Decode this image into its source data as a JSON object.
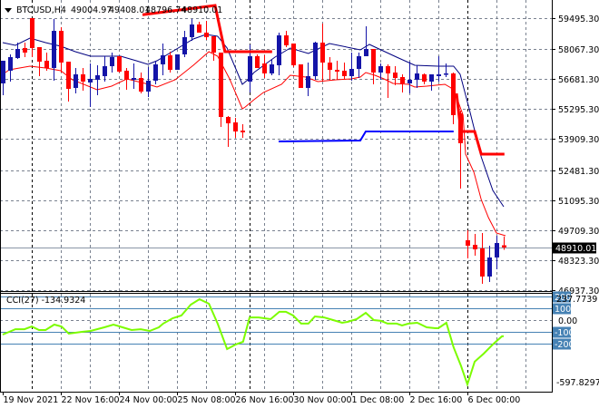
{
  "header": {
    "symbol": "BTCUSD,H4",
    "open": "49004.97",
    "high": "49408.01",
    "low": "48796.74",
    "close": "48910.01",
    "menu_icon": "triangle-down-icon"
  },
  "indicator": {
    "label": "CCI(27) -134.9324",
    "top_value": "237.7739",
    "bottom_value": "-597.8297",
    "levels": [
      {
        "value": 200,
        "label": "200",
        "boxed": true
      },
      {
        "value": 100,
        "label": "100",
        "boxed": true
      },
      {
        "value": 0,
        "label": "0.00",
        "boxed": false
      },
      {
        "value": -100,
        "label": "-100",
        "boxed": true
      },
      {
        "value": -200,
        "label": "-200",
        "boxed": true
      }
    ]
  },
  "colors": {
    "bull": "#1414a8",
    "bear": "#ff0000",
    "ma_fast": "#000080",
    "ma_slow": "#ff0000",
    "step_upper": "#ff0000",
    "step_lower": "#0000ff",
    "cci": "#7cfc00",
    "level_line": "#4682b4",
    "label_box": "#4682b4",
    "grid": "#7a8290"
  },
  "chart_data": {
    "type": "candlestick",
    "title": "BTCUSD,H4",
    "price_ticks": [
      "59495.30",
      "58067.30",
      "56681.30",
      "55295.30",
      "53909.30",
      "52481.30",
      "51095.30",
      "49709.30",
      "48323.30",
      "46937.30"
    ],
    "current_price": "48910.01",
    "time_labels": [
      {
        "bar": 0,
        "label": "19 Nov 2021"
      },
      {
        "bar": 8,
        "label": "22 Nov 16:00"
      },
      {
        "bar": 16,
        "label": "24 Nov 00:00"
      },
      {
        "bar": 24,
        "label": "25 Nov 08:00"
      },
      {
        "bar": 32,
        "label": "26 Nov 16:00"
      },
      {
        "bar": 40,
        "label": "30 Nov 00:00"
      },
      {
        "bar": 48,
        "label": "1 Dec 08:00"
      },
      {
        "bar": 56,
        "label": "2 Dec 16:00"
      },
      {
        "bar": 64,
        "label": "6 Dec 00:00"
      }
    ],
    "period_separators": [
      4,
      34,
      64
    ],
    "ohlc": [
      [
        56481,
        57528,
        55937,
        57528
      ],
      [
        57067,
        57821,
        56565,
        57695
      ],
      [
        57653,
        58365,
        57611,
        58072
      ],
      [
        58114,
        58365,
        57695,
        57904
      ],
      [
        59496,
        59496,
        57695,
        58114
      ],
      [
        58156,
        58156,
        56816,
        57486
      ],
      [
        57528,
        57904,
        57067,
        57193
      ],
      [
        57193,
        59454,
        56607,
        58909
      ],
      [
        58909,
        59077,
        56983,
        57444
      ],
      [
        57486,
        57486,
        55644,
        56230
      ],
      [
        56272,
        57193,
        56020,
        56900
      ],
      [
        56900,
        57193,
        56146,
        56565
      ],
      [
        56523,
        57402,
        55393,
        56690
      ],
      [
        56648,
        57318,
        55937,
        56858
      ],
      [
        56816,
        57737,
        56565,
        57276
      ],
      [
        57276,
        57904,
        56983,
        57695
      ],
      [
        57737,
        57737,
        56983,
        57025
      ],
      [
        57067,
        57193,
        56188,
        56648
      ],
      [
        56648,
        57402,
        56230,
        56732
      ],
      [
        56732,
        56983,
        56020,
        56104
      ],
      [
        56104,
        57235,
        55853,
        56607
      ],
      [
        56607,
        57528,
        56439,
        57360
      ],
      [
        57360,
        58323,
        56858,
        57779
      ],
      [
        57779,
        57946,
        56983,
        57109
      ],
      [
        57109,
        57821,
        57109,
        57821
      ],
      [
        57821,
        58909,
        57695,
        58616
      ],
      [
        58616,
        59454,
        58449,
        59203
      ],
      [
        59203,
        59328,
        58826,
        58826
      ],
      [
        58826,
        59370,
        58491,
        58616
      ],
      [
        58658,
        58658,
        57528,
        57904
      ],
      [
        57904,
        57904,
        54471,
        54932
      ],
      [
        54932,
        54974,
        53550,
        54638
      ],
      [
        54680,
        54890,
        53969,
        54262
      ],
      [
        54304,
        54597,
        53969,
        54220
      ],
      [
        56565,
        58281,
        56062,
        57737
      ],
      [
        57737,
        57821,
        57193,
        57193
      ],
      [
        57402,
        57779,
        56732,
        56942
      ],
      [
        56942,
        57570,
        56858,
        57360
      ],
      [
        57318,
        58826,
        56858,
        58700
      ],
      [
        58700,
        58909,
        58156,
        58240
      ],
      [
        58323,
        58323,
        57235,
        57318
      ],
      [
        57360,
        57360,
        56272,
        56272
      ],
      [
        56272,
        57444,
        55895,
        56816
      ],
      [
        56816,
        58407,
        56648,
        58365
      ],
      [
        58365,
        59244,
        56565,
        57444
      ],
      [
        57444,
        57695,
        56607,
        57109
      ],
      [
        57109,
        57528,
        56648,
        57025
      ],
      [
        57067,
        57444,
        56690,
        56816
      ],
      [
        56816,
        57904,
        56607,
        57151
      ],
      [
        57151,
        57904,
        56732,
        57737
      ],
      [
        57737,
        59119,
        57737,
        58072
      ],
      [
        58072,
        58072,
        56439,
        56983
      ],
      [
        56983,
        57402,
        56648,
        57276
      ],
      [
        57276,
        57360,
        55811,
        56942
      ],
      [
        56983,
        57276,
        56397,
        56732
      ],
      [
        56774,
        56900,
        56062,
        56481
      ],
      [
        56481,
        57486,
        56020,
        56648
      ],
      [
        56648,
        57318,
        56272,
        56942
      ],
      [
        56900,
        56942,
        56439,
        56565
      ],
      [
        56565,
        56900,
        56146,
        56900
      ],
      [
        56816,
        57737,
        56565,
        56900
      ],
      [
        56900,
        57402,
        56774,
        56942
      ],
      [
        56942,
        56983,
        54597,
        55016
      ],
      [
        55100,
        55225,
        51624,
        53718
      ],
      [
        49237,
        49698,
        48400,
        48986
      ],
      [
        49027,
        49530,
        48526,
        48818
      ],
      [
        48860,
        49572,
        47228,
        47563
      ],
      [
        47563,
        48986,
        47312,
        48442
      ],
      [
        48442,
        49447,
        47898,
        49111
      ],
      [
        49004.97,
        49408.01,
        48796.74,
        48910.01
      ]
    ],
    "ma_fast": [
      [
        0,
        58365
      ],
      [
        1.75,
        58240
      ],
      [
        3.75,
        58574
      ],
      [
        5.9,
        58365
      ],
      [
        8,
        58198
      ],
      [
        10,
        57946
      ],
      [
        12.1,
        57737
      ],
      [
        14.25,
        57737
      ],
      [
        16.25,
        57737
      ],
      [
        18.4,
        57528
      ],
      [
        20,
        57360
      ],
      [
        21.25,
        57528
      ],
      [
        23.75,
        58030
      ],
      [
        26.25,
        58533
      ],
      [
        28,
        58742
      ],
      [
        29.6,
        58658
      ],
      [
        30.9,
        58114
      ],
      [
        33,
        56439
      ],
      [
        33.75,
        56648
      ],
      [
        34.6,
        56983
      ],
      [
        37.5,
        57695
      ],
      [
        39.6,
        58114
      ],
      [
        42.1,
        57863
      ],
      [
        45,
        58323
      ],
      [
        49.25,
        58030
      ],
      [
        50.5,
        58281
      ],
      [
        52.1,
        58030
      ],
      [
        54.25,
        57695
      ],
      [
        56.75,
        57318
      ],
      [
        60,
        57276
      ],
      [
        62.1,
        57276
      ],
      [
        63,
        56900
      ],
      [
        64.25,
        55309
      ],
      [
        65.5,
        53634
      ],
      [
        65.9,
        53090
      ],
      [
        67.5,
        51540
      ],
      [
        69,
        50787
      ]
    ],
    "ma_slow": [
      [
        0,
        56900
      ],
      [
        0.9,
        57109
      ],
      [
        3.75,
        57276
      ],
      [
        5.9,
        57193
      ],
      [
        8,
        57067
      ],
      [
        9.6,
        56648
      ],
      [
        13,
        56188
      ],
      [
        15,
        56356
      ],
      [
        17.1,
        56690
      ],
      [
        19.6,
        56481
      ],
      [
        21.25,
        56314
      ],
      [
        23.75,
        56648
      ],
      [
        26.25,
        57318
      ],
      [
        28.4,
        57946
      ],
      [
        29.6,
        57737
      ],
      [
        31.25,
        56690
      ],
      [
        33,
        55309
      ],
      [
        33.4,
        55393
      ],
      [
        34.6,
        55728
      ],
      [
        35.9,
        56062
      ],
      [
        38.4,
        56439
      ],
      [
        39.6,
        56858
      ],
      [
        41.75,
        56774
      ],
      [
        43.4,
        56565
      ],
      [
        45.9,
        56648
      ],
      [
        48,
        56690
      ],
      [
        49.25,
        56774
      ],
      [
        50,
        56983
      ],
      [
        51.25,
        56858
      ],
      [
        52.5,
        56690
      ],
      [
        53.75,
        56481
      ],
      [
        55.9,
        56439
      ],
      [
        56.75,
        56314
      ],
      [
        58.4,
        56356
      ],
      [
        60.9,
        56439
      ],
      [
        61.75,
        56272
      ],
      [
        62.5,
        55853
      ],
      [
        63.4,
        55016
      ],
      [
        63.75,
        53216
      ],
      [
        64.9,
        52378
      ],
      [
        65.9,
        51122
      ],
      [
        66.9,
        50285
      ],
      [
        68,
        49572
      ],
      [
        69.25,
        49447
      ]
    ],
    "step_upper": [
      [
        [
          19.25,
          59649
        ],
        [
          29.25,
          60082
        ],
        [
          30.6,
          57946
        ],
        [
          37.1,
          57946
        ]
      ],
      [
        [
          62.5,
          56020
        ],
        [
          63.1,
          54262
        ],
        [
          65,
          54262
        ],
        [
          65.9,
          53216
        ],
        [
          69.1,
          53216
        ]
      ]
    ],
    "step_lower": [
      [
        38,
        53801
      ],
      [
        49.25,
        53843
      ],
      [
        50,
        54262
      ],
      [
        62.1,
        54262
      ]
    ],
    "cci": [
      [
        0,
        -121
      ],
      [
        1.75,
        -75
      ],
      [
        3,
        -75
      ],
      [
        4,
        -52
      ],
      [
        5,
        -82
      ],
      [
        5.9,
        -82
      ],
      [
        7.1,
        -36
      ],
      [
        8.1,
        -52
      ],
      [
        9.1,
        -113
      ],
      [
        10.9,
        -98
      ],
      [
        12.1,
        -90
      ],
      [
        14,
        -59
      ],
      [
        15.25,
        -36
      ],
      [
        16.5,
        -59
      ],
      [
        17.75,
        -82
      ],
      [
        19,
        -75
      ],
      [
        20.25,
        -90
      ],
      [
        21.5,
        -59
      ],
      [
        22.1,
        -28
      ],
      [
        23.4,
        18
      ],
      [
        24.6,
        41
      ],
      [
        25.9,
        133
      ],
      [
        27.1,
        179
      ],
      [
        28.4,
        141
      ],
      [
        29.6,
        -28
      ],
      [
        30.9,
        -244
      ],
      [
        32.1,
        -205
      ],
      [
        33.1,
        -182
      ],
      [
        34,
        25
      ],
      [
        35.25,
        25
      ],
      [
        36.9,
        10
      ],
      [
        38.1,
        72
      ],
      [
        39,
        72
      ],
      [
        40,
        41
      ],
      [
        41.1,
        -28
      ],
      [
        42.1,
        -28
      ],
      [
        43,
        33
      ],
      [
        44.25,
        25
      ],
      [
        45.5,
        2
      ],
      [
        46.75,
        -21
      ],
      [
        47.5,
        -13
      ],
      [
        48.75,
        10
      ],
      [
        50,
        64
      ],
      [
        51.1,
        2
      ],
      [
        52.1,
        -5
      ],
      [
        53,
        -28
      ],
      [
        54.25,
        -28
      ],
      [
        55,
        -44
      ],
      [
        55.9,
        -28
      ],
      [
        57.1,
        -21
      ],
      [
        58.4,
        -59
      ],
      [
        59.6,
        -67
      ],
      [
        60,
        -67
      ],
      [
        61.1,
        -21
      ],
      [
        62.1,
        -229
      ],
      [
        63.1,
        -383
      ],
      [
        64,
        -544
      ],
      [
        65,
        -351
      ],
      [
        66.25,
        -282
      ],
      [
        67.5,
        -205
      ],
      [
        68.75,
        -136
      ],
      [
        69,
        -134.9324
      ]
    ]
  }
}
